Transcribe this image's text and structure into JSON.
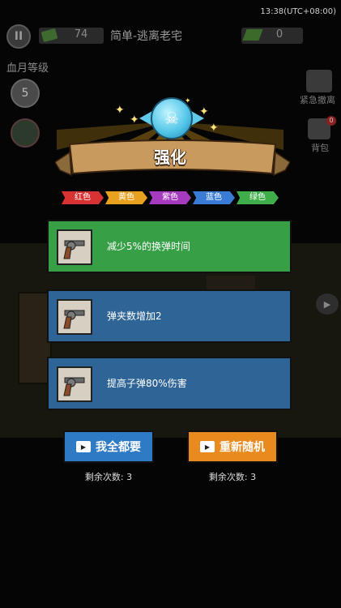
{
  "status": {
    "time": "13:38(UTC+08:00)"
  },
  "hud": {
    "cash": "74",
    "level_title": "简单-逃离老宅",
    "tickets": "0",
    "blood_label": "血月等级",
    "blood_level": "5",
    "emergency_label": "紧急撤离",
    "bag_label": "背包",
    "bag_badge": "0"
  },
  "popup": {
    "title": "强化",
    "rarity_tags": [
      "红色",
      "黄色",
      "紫色",
      "蓝色",
      "绿色"
    ],
    "options": [
      {
        "text": "减少5%的换弹时间",
        "icon": "revolver-icon",
        "color": "#37a047"
      },
      {
        "text": "弹夹数增加2",
        "icon": "revolver-icon",
        "color": "#2e6496"
      },
      {
        "text": "提高子弹80%伤害",
        "icon": "revolver-icon",
        "color": "#2e6496"
      }
    ],
    "buttons": {
      "take_all": "我全都要",
      "reroll": "重新随机"
    },
    "remaining_left": "剩余次数: 3",
    "remaining_right": "剩余次数: 3"
  },
  "colors": {
    "tag_red": "#d83232",
    "tag_yellow": "#e8a020",
    "tag_purple": "#a63bc0",
    "tag_blue": "#3a7bd5",
    "tag_green": "#3fae4a",
    "btn_blue": "#2f7ac4",
    "btn_orange": "#e88a1e"
  }
}
